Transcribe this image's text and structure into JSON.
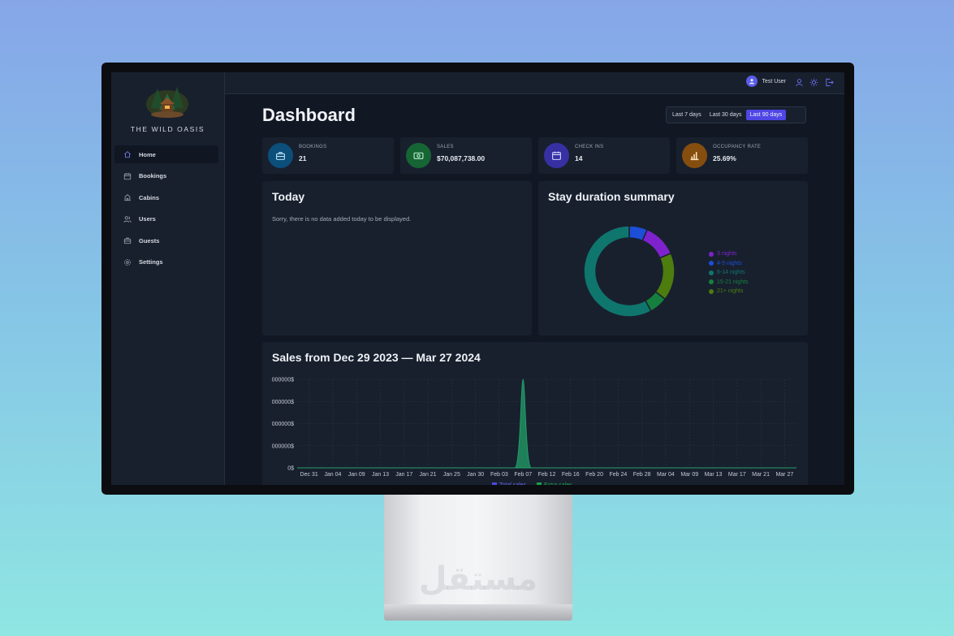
{
  "app": {
    "brand": "THE WILD OASIS",
    "stand_watermark": "مستقل"
  },
  "sidebar": {
    "items": [
      {
        "label": "Home",
        "icon": "home-icon",
        "active": true
      },
      {
        "label": "Bookings",
        "icon": "calendar-icon",
        "active": false
      },
      {
        "label": "Cabins",
        "icon": "cabin-icon",
        "active": false
      },
      {
        "label": "Users",
        "icon": "users-icon",
        "active": false
      },
      {
        "label": "Guests",
        "icon": "briefcase-icon",
        "active": false
      },
      {
        "label": "Settings",
        "icon": "gear-icon",
        "active": false
      }
    ]
  },
  "header": {
    "user_name": "Test User",
    "icons": [
      "user-icon",
      "sun-icon",
      "logout-icon"
    ]
  },
  "main": {
    "title": "Dashboard",
    "filters": [
      {
        "label": "Last 7 days",
        "active": false
      },
      {
        "label": "Last 30 days",
        "active": false
      },
      {
        "label": "Last 90 days",
        "active": true
      }
    ],
    "stats": [
      {
        "label": "BOOKINGS",
        "value": "21",
        "icon": "briefcase-icon",
        "color": "#0b4f7a",
        "icon_color": "#bfe3f8"
      },
      {
        "label": "SALES",
        "value": "$70,087,738.00",
        "icon": "banknote-icon",
        "color": "#166534",
        "icon_color": "#bff0cf"
      },
      {
        "label": "CHECK INS",
        "value": "14",
        "icon": "calendar-icon",
        "color": "#3730a3",
        "icon_color": "#d3d6ff"
      },
      {
        "label": "OCCUPANCY RATE",
        "value": "25.69%",
        "icon": "bar-chart-icon",
        "color": "#854d0e",
        "icon_color": "#fbe6bd"
      }
    ],
    "today": {
      "title": "Today",
      "empty_text": "Sorry, there is no data added today to be displayed."
    },
    "duration": {
      "title": "Stay duration summary"
    },
    "sales": {
      "title": "Sales from Dec 29 2023 — Mar 27 2024"
    }
  },
  "chart_data": [
    {
      "type": "pie",
      "title": "Stay duration summary",
      "donut": true,
      "labels": [
        "3 nights",
        "4-5 nights",
        "6-14 nights",
        "15-21 nights",
        "21+ nights"
      ],
      "values": [
        12.0,
        6.5,
        58.0,
        6.5,
        17.0
      ],
      "order_clockwise_from_top": [
        "4-5 nights",
        "3 nights",
        "21+ nights",
        "15-21 nights",
        "6-14 nights"
      ],
      "colors": {
        "3 nights": "#7e22ce",
        "4-5 nights": "#1d4ed8",
        "6-14 nights": "#0f766e",
        "15-21 nights": "#15803d",
        "21+ nights": "#4d7c0f"
      },
      "legend": "right"
    },
    {
      "type": "area",
      "title": "Sales from Dec 29 2023 — Mar 27 2024",
      "x": [
        "Dec 31",
        "Jan 04",
        "Jan 09",
        "Jan 13",
        "Jan 17",
        "Jan 21",
        "Jan 25",
        "Jan 30",
        "Feb 03",
        "Feb 07",
        "Feb 12",
        "Feb 16",
        "Feb 20",
        "Feb 24",
        "Feb 28",
        "Mar 04",
        "Mar 09",
        "Mar 13",
        "Mar 17",
        "Mar 21",
        "Mar 27"
      ],
      "series": [
        {
          "name": "Total sales",
          "color": "#4f46e5",
          "values": [
            0,
            0,
            0,
            0,
            0,
            0,
            0,
            0,
            0,
            40000000,
            0,
            0,
            0,
            0,
            0,
            0,
            0,
            0,
            0,
            0,
            0
          ]
        },
        {
          "name": "Extra sales",
          "color": "#16a34a",
          "values": [
            0,
            0,
            0,
            0,
            0,
            0,
            0,
            0,
            0,
            0,
            0,
            0,
            0,
            0,
            0,
            0,
            0,
            0,
            0,
            0,
            0
          ]
        }
      ],
      "y_tick_labels": [
        "0$",
        "000000$",
        "000000$",
        "000000$",
        "000000$"
      ],
      "ylim": [
        0,
        40000000
      ],
      "grid": true,
      "legend": "bottom"
    }
  ]
}
